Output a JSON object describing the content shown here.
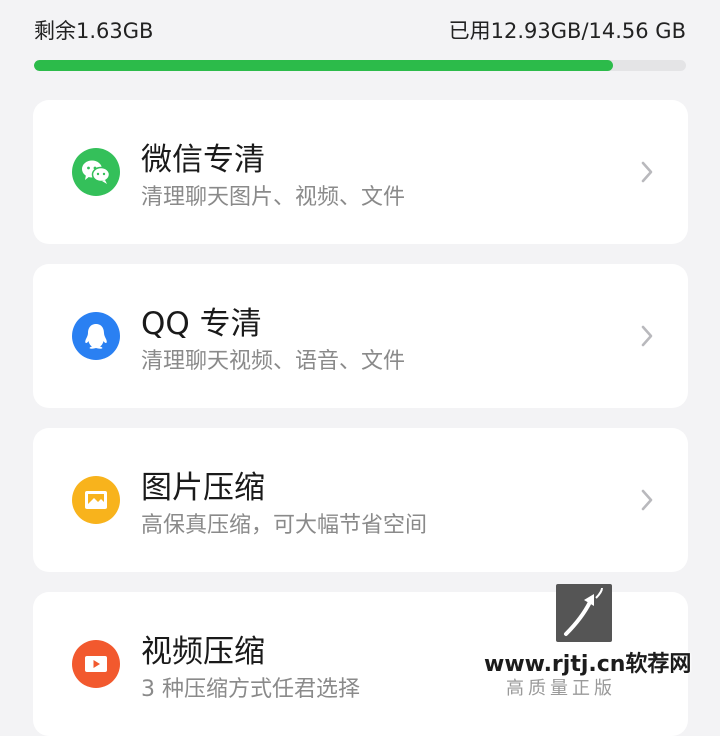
{
  "storage": {
    "remaining": "剩余1.63GB",
    "used": "已用12.93GB/14.56 GB",
    "used_fraction": 0.888,
    "bar_color": "#2cbb4a"
  },
  "cards": [
    {
      "title": "微信专清",
      "subtitle": "清理聊天图片、视频、文件",
      "icon": "wechat-icon",
      "color": "#34c05a"
    },
    {
      "title": "QQ 专清",
      "subtitle": "清理聊天视频、语音、文件",
      "icon": "qq-penguin-icon",
      "color": "#2a80f2"
    },
    {
      "title": "图片压缩",
      "subtitle": "高保真压缩，可大幅节省空间",
      "icon": "image-icon",
      "color": "#f8b31c"
    },
    {
      "title": "视频压缩",
      "subtitle": "3 种压缩方式任君选择",
      "icon": "video-icon",
      "color": "#f2592e"
    }
  ],
  "watermark": {
    "site": "www.rjtj.cn软荐网",
    "slogan": "高质量正版"
  }
}
